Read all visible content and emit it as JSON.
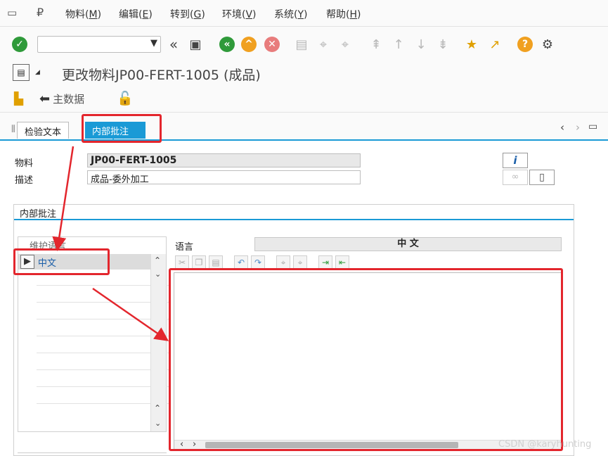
{
  "menu": [
    {
      "label": "物料(",
      "key": "M",
      "tail": ")"
    },
    {
      "label": "编辑(",
      "key": "E",
      "tail": ")"
    },
    {
      "label": "转到(",
      "key": "G",
      "tail": ")"
    },
    {
      "label": "环境(",
      "key": "V",
      "tail": ")"
    },
    {
      "label": "系统(",
      "key": "Y",
      "tail": ")"
    },
    {
      "label": "帮助(",
      "key": "H",
      "tail": ")"
    }
  ],
  "title": "更改物料JP00-FERT-1005 (成品)",
  "app_toolbar": {
    "main_data": "主数据"
  },
  "tabs": [
    {
      "label": "检验文本",
      "active": false
    },
    {
      "label": "内部批注",
      "active": true
    }
  ],
  "form": {
    "material_label": "物料",
    "material_value": "JP00-FERT-1005",
    "desc_label": "描述",
    "desc_value": "成品-委外加工"
  },
  "group": {
    "title": "内部批注",
    "maintain_lang_header": "维护语言",
    "lang_items": [
      "中文"
    ],
    "lang_col_label": "语言",
    "lang_col_value": "中 文"
  },
  "colors": {
    "accent": "#1a9ad6",
    "highlight": "#e3262d"
  },
  "watermark": "CSDN @karyhunting"
}
